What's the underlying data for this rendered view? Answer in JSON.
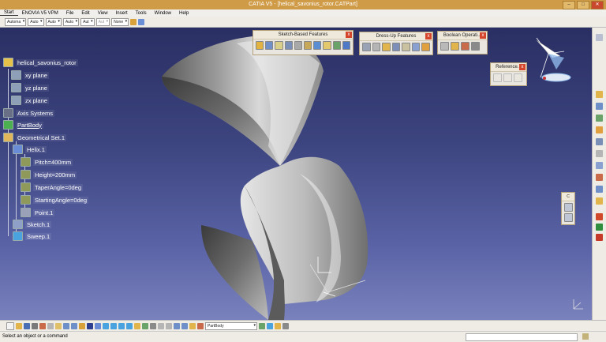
{
  "window": {
    "title": "CATIA V5 - [helical_savonius_rotor.CATPart]"
  },
  "menu": [
    "Start",
    "ENOVIA V5 VPM",
    "File",
    "Edit",
    "View",
    "Insert",
    "Tools",
    "Window",
    "Help"
  ],
  "top_toolbar": {
    "combos": [
      "Automa",
      "Auto",
      "Auto",
      "Auto",
      "Aut",
      "Aut",
      "None"
    ]
  },
  "tree": {
    "root": "helical_savonius_rotor",
    "planes": [
      "xy plane",
      "yz plane",
      "zx plane"
    ],
    "axis_systems": "Axis Systems",
    "part_body": "PartBody",
    "geometrical_set": "Geometrical Set.1",
    "helix": "Helix.1",
    "helix_params": [
      "Pitch=400mm",
      "Height=200mm",
      "TaperAngle=0deg",
      "StartingAngle=0deg"
    ],
    "point": "Point.1",
    "sketch": "Sketch.1",
    "sweep": "Sweep.1"
  },
  "panels": {
    "sketch_based": "Sketch-Based Features",
    "dress_up": "Dress-Up Features",
    "boolean": "Boolean Operati...",
    "reference": "Reference...",
    "small": "C",
    "close_glyph": "x"
  },
  "bottom_toolbar": {
    "body_select": "PartBody"
  },
  "status": {
    "text": "Select an object or a command"
  },
  "colors": {
    "viewport_top": "#2a2f63",
    "viewport_bottom": "#7a82bd",
    "titlebar": "#cf9b47"
  },
  "icons": [
    "catia-logo-icon",
    "compass-icon",
    "close-icon",
    "minimize-icon",
    "maximize-icon"
  ]
}
